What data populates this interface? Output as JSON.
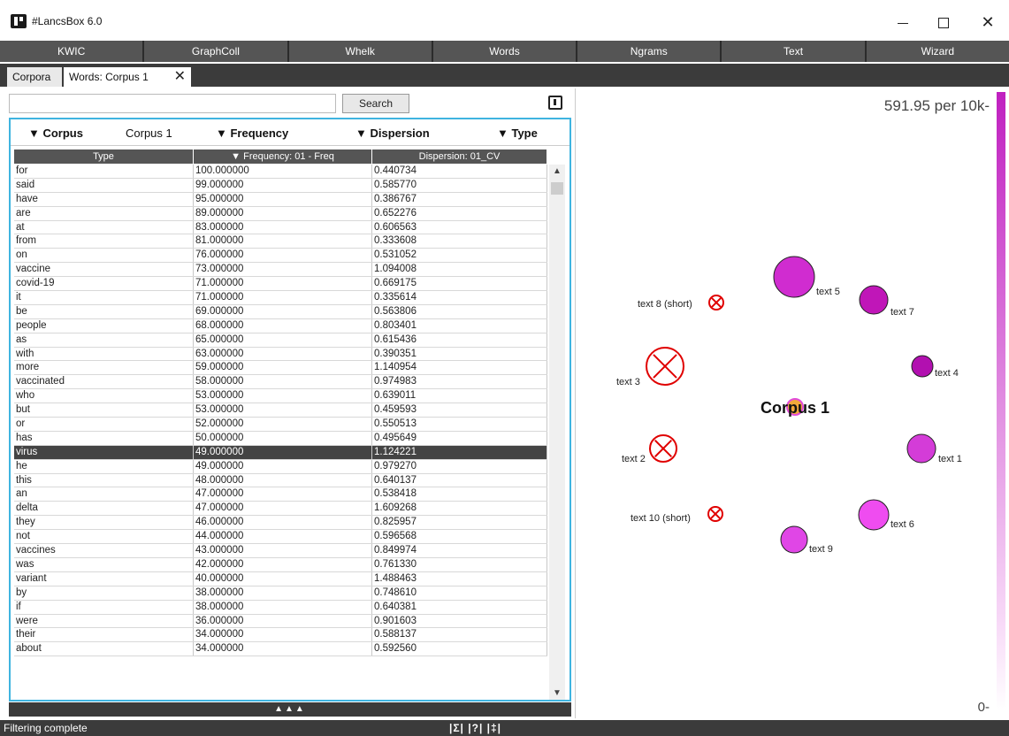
{
  "window": {
    "title": "#LancsBox 6.0"
  },
  "toolbar": [
    "KWIC",
    "GraphColl",
    "Whelk",
    "Words",
    "Ngrams",
    "Text",
    "Wizard"
  ],
  "tabs": {
    "corpora": "Corpora",
    "words": "Words: Corpus 1"
  },
  "search": {
    "button": "Search",
    "value": ""
  },
  "filters": {
    "corpus_label": "▼ Corpus",
    "corpus_value": "Corpus 1",
    "frequency_label": "▼ Frequency",
    "dispersion_label": "▼ Dispersion",
    "type_label": "▼ Type"
  },
  "columns": {
    "type": "Type",
    "frequency": "▼ Frequency: 01 - Freq",
    "dispersion": "Dispersion: 01_CV"
  },
  "rows": [
    [
      "for",
      "100.000000",
      "0.440734"
    ],
    [
      "said",
      "99.000000",
      "0.585770"
    ],
    [
      "have",
      "95.000000",
      "0.386767"
    ],
    [
      "are",
      "89.000000",
      "0.652276"
    ],
    [
      "at",
      "83.000000",
      "0.606563"
    ],
    [
      "from",
      "81.000000",
      "0.333608"
    ],
    [
      "on",
      "76.000000",
      "0.531052"
    ],
    [
      "vaccine",
      "73.000000",
      "1.094008"
    ],
    [
      "covid-19",
      "71.000000",
      "0.669175"
    ],
    [
      "it",
      "71.000000",
      "0.335614"
    ],
    [
      "be",
      "69.000000",
      "0.563806"
    ],
    [
      "people",
      "68.000000",
      "0.803401"
    ],
    [
      "as",
      "65.000000",
      "0.615436"
    ],
    [
      "with",
      "63.000000",
      "0.390351"
    ],
    [
      "more",
      "59.000000",
      "1.140954"
    ],
    [
      "vaccinated",
      "58.000000",
      "0.974983"
    ],
    [
      "who",
      "53.000000",
      "0.639011"
    ],
    [
      "but",
      "53.000000",
      "0.459593"
    ],
    [
      "or",
      "52.000000",
      "0.550513"
    ],
    [
      "has",
      "50.000000",
      "0.495649"
    ],
    [
      "virus",
      "49.000000",
      "1.124221"
    ],
    [
      "he",
      "49.000000",
      "0.979270"
    ],
    [
      "this",
      "48.000000",
      "0.640137"
    ],
    [
      "an",
      "47.000000",
      "0.538418"
    ],
    [
      "delta",
      "47.000000",
      "1.609268"
    ],
    [
      "they",
      "46.000000",
      "0.825957"
    ],
    [
      "not",
      "44.000000",
      "0.596568"
    ],
    [
      "vaccines",
      "43.000000",
      "0.849974"
    ],
    [
      "was",
      "42.000000",
      "0.761330"
    ],
    [
      "variant",
      "40.000000",
      "1.488463"
    ],
    [
      "by",
      "38.000000",
      "0.748610"
    ],
    [
      "if",
      "38.000000",
      "0.640381"
    ],
    [
      "were",
      "36.000000",
      "0.901603"
    ],
    [
      "their",
      "34.000000",
      "0.588137"
    ],
    [
      "about",
      "34.000000",
      "0.592560"
    ]
  ],
  "selected_row": "virus",
  "collapse_label": "▲▲▲",
  "plot": {
    "rate_top": "591.95 per 10k-",
    "rate_bottom": "0-",
    "center": "Corpus 1",
    "nodes": [
      {
        "label": "text 5",
        "color": "#d02cd0",
        "status": "ok"
      },
      {
        "label": "text 7",
        "color": "#c016b8",
        "status": "ok"
      },
      {
        "label": "text 8 (short)",
        "color": "#e00000",
        "status": "excluded"
      },
      {
        "label": "text 3",
        "color": "#e00000",
        "status": "excluded"
      },
      {
        "label": "text 4",
        "color": "#b210b0",
        "status": "ok"
      },
      {
        "label": "text 2",
        "color": "#e00000",
        "status": "excluded"
      },
      {
        "label": "text 1",
        "color": "#d43cd8",
        "status": "ok"
      },
      {
        "label": "text 10 (short)",
        "color": "#e00000",
        "status": "excluded"
      },
      {
        "label": "text 6",
        "color": "#ef4cf0",
        "status": "ok"
      },
      {
        "label": "text 9",
        "color": "#e046e6",
        "status": "ok"
      }
    ]
  },
  "status": {
    "text": "Filtering complete",
    "tools": "|Σ| |?| |‡|"
  }
}
